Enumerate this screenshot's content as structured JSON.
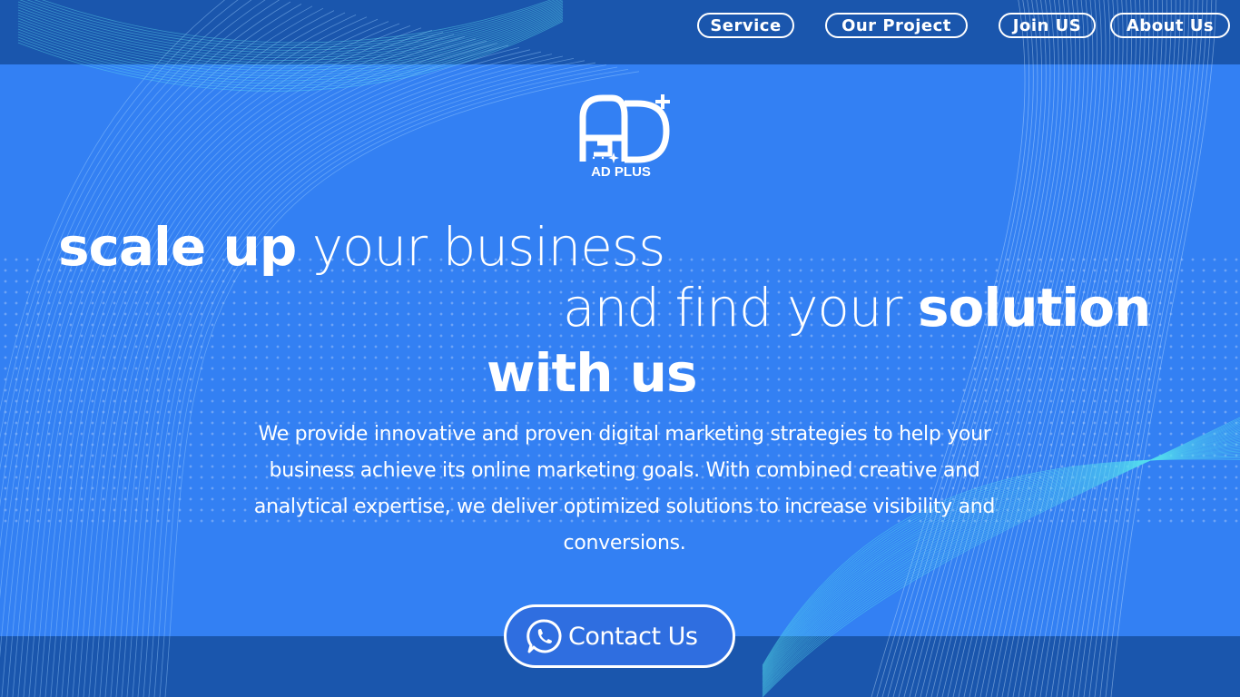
{
  "nav": {
    "service": "Service",
    "project": "Our Project",
    "join": "Join US",
    "about": "About Us"
  },
  "brand": {
    "name": "AD PLUS"
  },
  "hero": {
    "line1_bold": "scale up",
    "line1_light": " your business",
    "line2_light": "and find your ",
    "line2_bold": "solution",
    "line3_bold": "with us"
  },
  "description": "We provide innovative and proven digital marketing strategies to help your business achieve its online marketing goals. With combined creative and analytical expertise, we deliver optimized solutions to increase visibility and conversions.",
  "cta": {
    "label": "Contact Us",
    "icon": "whatsapp-icon"
  },
  "colors": {
    "background": "#3380f3",
    "bar": "#1a56ad",
    "text": "#ffffff"
  }
}
